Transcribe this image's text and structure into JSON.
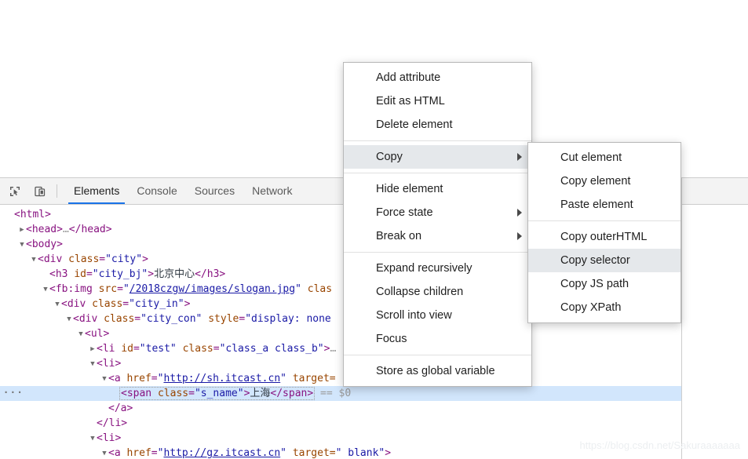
{
  "devtools": {
    "toolbar": {
      "inspect_icon": "inspect-element-icon",
      "device_icon": "device-toolbar-icon",
      "tabs": [
        {
          "label": "Elements",
          "active": true
        },
        {
          "label": "Console",
          "active": false
        },
        {
          "label": "Sources",
          "active": false
        },
        {
          "label": "Network",
          "active": false
        }
      ]
    },
    "dom_tree": {
      "rows": [
        {
          "indent": 0,
          "twisty": "none",
          "selected": false,
          "parts": [
            {
              "t": "tg",
              "s": "<html>"
            }
          ]
        },
        {
          "indent": 1,
          "twisty": "collapsed",
          "selected": false,
          "parts": [
            {
              "t": "tg",
              "s": "<head>"
            },
            {
              "t": "dim",
              "s": "…"
            },
            {
              "t": "tg",
              "s": "</head>"
            }
          ]
        },
        {
          "indent": 1,
          "twisty": "expanded",
          "selected": false,
          "parts": [
            {
              "t": "tg",
              "s": "<body>"
            }
          ]
        },
        {
          "indent": 2,
          "twisty": "expanded",
          "selected": false,
          "parts": [
            {
              "t": "tg",
              "s": "<div "
            },
            {
              "t": "at",
              "s": "class"
            },
            {
              "t": "tg",
              "s": "="
            },
            {
              "t": "av",
              "s": "\"city\""
            },
            {
              "t": "tg",
              "s": ">"
            }
          ]
        },
        {
          "indent": 3,
          "twisty": "none",
          "selected": false,
          "parts": [
            {
              "t": "tg",
              "s": "<h3 "
            },
            {
              "t": "at",
              "s": "id"
            },
            {
              "t": "tg",
              "s": "="
            },
            {
              "t": "av",
              "s": "\"city_bj\""
            },
            {
              "t": "tg",
              "s": ">"
            },
            {
              "t": "txt",
              "s": "北京中心"
            },
            {
              "t": "tg",
              "s": "</h3>"
            }
          ]
        },
        {
          "indent": 3,
          "twisty": "expanded",
          "selected": false,
          "parts": [
            {
              "t": "tg",
              "s": "<fb:img "
            },
            {
              "t": "at",
              "s": "src"
            },
            {
              "t": "tg",
              "s": "="
            },
            {
              "t": "av",
              "s": "\""
            },
            {
              "t": "link",
              "s": "/2018czgw/images/slogan.jpg"
            },
            {
              "t": "av",
              "s": "\""
            },
            {
              "t": "at",
              "s": " clas"
            }
          ]
        },
        {
          "indent": 4,
          "twisty": "expanded",
          "selected": false,
          "parts": [
            {
              "t": "tg",
              "s": "<div "
            },
            {
              "t": "at",
              "s": "class"
            },
            {
              "t": "tg",
              "s": "="
            },
            {
              "t": "av",
              "s": "\"city_in\""
            },
            {
              "t": "tg",
              "s": ">"
            }
          ]
        },
        {
          "indent": 5,
          "twisty": "expanded",
          "selected": false,
          "parts": [
            {
              "t": "tg",
              "s": "<div "
            },
            {
              "t": "at",
              "s": "class"
            },
            {
              "t": "tg",
              "s": "="
            },
            {
              "t": "av",
              "s": "\"city_con\""
            },
            {
              "t": "at",
              "s": " style"
            },
            {
              "t": "tg",
              "s": "="
            },
            {
              "t": "av",
              "s": "\"display: none"
            }
          ]
        },
        {
          "indent": 6,
          "twisty": "expanded",
          "selected": false,
          "parts": [
            {
              "t": "tg",
              "s": "<ul>"
            }
          ]
        },
        {
          "indent": 7,
          "twisty": "collapsed",
          "selected": false,
          "parts": [
            {
              "t": "tg",
              "s": "<li "
            },
            {
              "t": "at",
              "s": "id"
            },
            {
              "t": "tg",
              "s": "="
            },
            {
              "t": "av",
              "s": "\"test\""
            },
            {
              "t": "at",
              "s": " class"
            },
            {
              "t": "tg",
              "s": "="
            },
            {
              "t": "av",
              "s": "\"class_a class_b\""
            },
            {
              "t": "tg",
              "s": ">"
            },
            {
              "t": "dim",
              "s": "…"
            }
          ]
        },
        {
          "indent": 7,
          "twisty": "expanded",
          "selected": false,
          "parts": [
            {
              "t": "tg",
              "s": "<li>"
            }
          ]
        },
        {
          "indent": 8,
          "twisty": "expanded",
          "selected": false,
          "parts": [
            {
              "t": "tg",
              "s": "<a "
            },
            {
              "t": "at",
              "s": "href"
            },
            {
              "t": "tg",
              "s": "="
            },
            {
              "t": "av",
              "s": "\""
            },
            {
              "t": "link",
              "s": "http://sh.itcast.cn"
            },
            {
              "t": "av",
              "s": "\""
            },
            {
              "t": "at",
              "s": " target="
            }
          ]
        },
        {
          "indent": 9,
          "twisty": "none",
          "selected": true,
          "gutter": "···",
          "parts": [
            {
              "t": "box_start",
              "s": ""
            },
            {
              "t": "tg",
              "s": "<span "
            },
            {
              "t": "at",
              "s": "class"
            },
            {
              "t": "tg",
              "s": "="
            },
            {
              "t": "av",
              "s": "\"s_name\""
            },
            {
              "t": "tg",
              "s": ">"
            },
            {
              "t": "txt",
              "s": "上海"
            },
            {
              "t": "tg",
              "s": "</span>"
            },
            {
              "t": "box_end",
              "s": ""
            },
            {
              "t": "dim",
              "s": "  == $0"
            }
          ]
        },
        {
          "indent": 8,
          "twisty": "none",
          "selected": false,
          "parts": [
            {
              "t": "tg",
              "s": "</a>"
            }
          ]
        },
        {
          "indent": 7,
          "twisty": "none",
          "selected": false,
          "parts": [
            {
              "t": "tg",
              "s": "</li>"
            }
          ]
        },
        {
          "indent": 7,
          "twisty": "expanded",
          "selected": false,
          "parts": [
            {
              "t": "tg",
              "s": "<li>"
            }
          ]
        },
        {
          "indent": 8,
          "twisty": "expanded",
          "selected": false,
          "parts": [
            {
              "t": "tg",
              "s": "<a "
            },
            {
              "t": "at",
              "s": "href"
            },
            {
              "t": "tg",
              "s": "="
            },
            {
              "t": "av",
              "s": "\""
            },
            {
              "t": "link",
              "s": "http://gz.itcast.cn"
            },
            {
              "t": "av",
              "s": "\""
            },
            {
              "t": "at",
              "s": " target="
            },
            {
              "t": "av",
              "s": "\" blank\""
            },
            {
              "t": "tg",
              "s": ">"
            }
          ]
        }
      ]
    }
  },
  "context_menu": {
    "items": [
      {
        "label": "Add attribute",
        "type": "item"
      },
      {
        "label": "Edit as HTML",
        "type": "item"
      },
      {
        "label": "Delete element",
        "type": "item"
      },
      {
        "type": "separator"
      },
      {
        "label": "Copy",
        "type": "item",
        "arrow": true,
        "highlight": true
      },
      {
        "type": "separator"
      },
      {
        "label": "Hide element",
        "type": "item"
      },
      {
        "label": "Force state",
        "type": "item",
        "arrow": true
      },
      {
        "label": "Break on",
        "type": "item",
        "arrow": true
      },
      {
        "type": "separator"
      },
      {
        "label": "Expand recursively",
        "type": "item"
      },
      {
        "label": "Collapse children",
        "type": "item"
      },
      {
        "label": "Scroll into view",
        "type": "item"
      },
      {
        "label": "Focus",
        "type": "item"
      },
      {
        "type": "separator"
      },
      {
        "label": "Store as global variable",
        "type": "item"
      }
    ]
  },
  "submenu": {
    "items": [
      {
        "label": "Cut element",
        "type": "item"
      },
      {
        "label": "Copy element",
        "type": "item"
      },
      {
        "label": "Paste element",
        "type": "item"
      },
      {
        "type": "separator"
      },
      {
        "label": "Copy outerHTML",
        "type": "item"
      },
      {
        "label": "Copy selector",
        "type": "item",
        "highlight": true
      },
      {
        "label": "Copy JS path",
        "type": "item"
      },
      {
        "label": "Copy XPath",
        "type": "item"
      }
    ]
  },
  "watermark": {
    "text": "https://blog.csdn.net/Sakuraaaaaaa"
  },
  "colors": {
    "accent": "#1a73e8",
    "selected_row": "#d2e6fc",
    "menu_highlight": "#e5e8eb",
    "tag": "#881280",
    "attr_name": "#994500",
    "attr_value": "#1a1aa6"
  }
}
